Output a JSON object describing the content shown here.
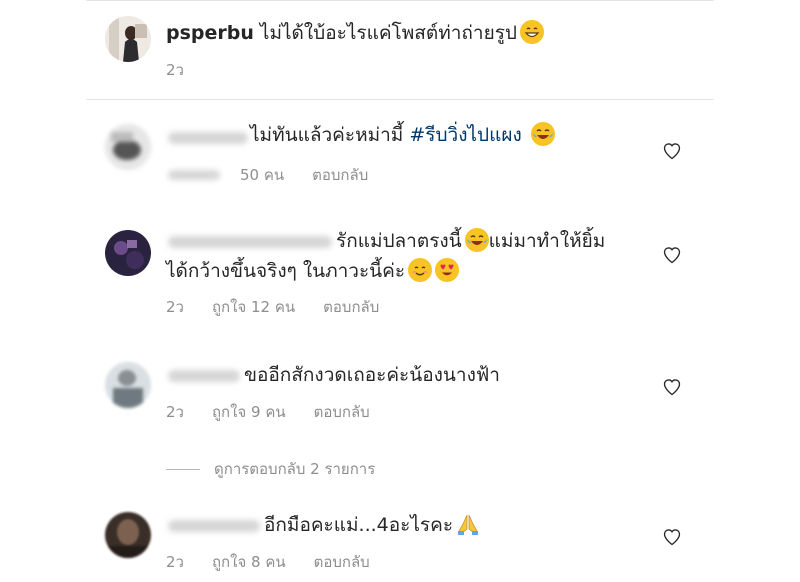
{
  "comments": [
    {
      "username": "psperbu",
      "text": "ไม่ได้ใบ้อะไรแค่โพสต์ท่าถ่ายรูป",
      "emoji": "grinning-face-icon",
      "time": "2ว"
    },
    {
      "text_before": "ไม่ทันแล้วค่ะหม่ามี้ ",
      "hashtag": "#รีบวิ่งไปแผง",
      "emoji": "joy-face-icon",
      "likes": "50 คน",
      "reply": "ตอบกลับ"
    },
    {
      "text": "รักแม่ปลาตรงนี้",
      "text2": "แม่มาทำให้ยิ้ม",
      "line2": "ได้กว้างขึ้นจริงๆ ในภาวะนี้ค่ะ",
      "time": "2ว",
      "likes": "ถูกใจ 12 คน",
      "reply": "ตอบกลับ"
    },
    {
      "text": "ขออีกสักงวดเถอะค่ะน้องนางฟ้า",
      "time": "2ว",
      "likes": "ถูกใจ 9 คน",
      "reply": "ตอบกลับ",
      "view_replies": "ดูการตอบกลับ 2 รายการ"
    },
    {
      "text": "อีกมือคะแม่...4อะไรคะ",
      "emoji": "folded-hands-icon",
      "time": "2ว",
      "likes": "ถูกใจ 8 คน",
      "reply": "ตอบกลับ"
    }
  ],
  "colors": {
    "text": "#262626",
    "meta": "#8e8e8e",
    "hashtag": "#00376b",
    "divider": "#e4e4e4"
  }
}
